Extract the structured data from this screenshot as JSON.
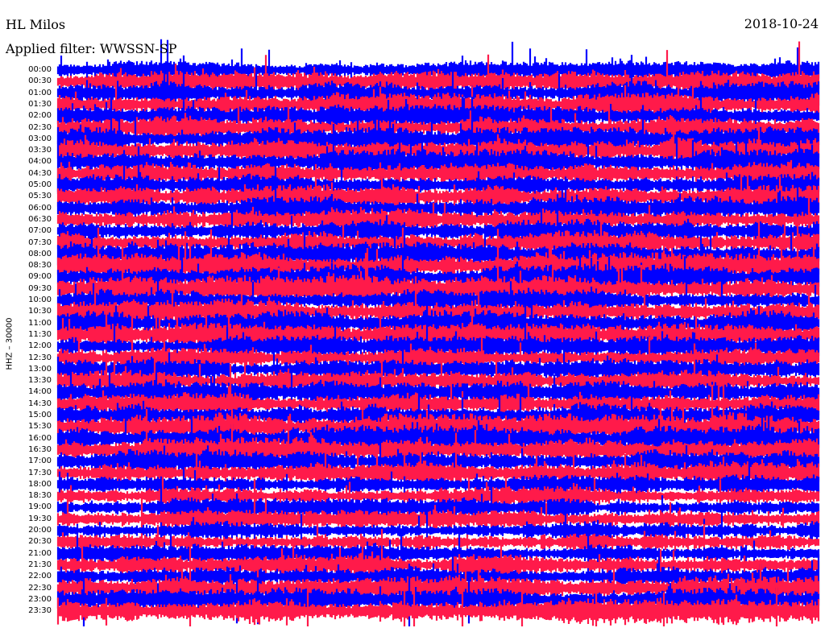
{
  "header": {
    "station": "HL Milos",
    "filter": "Applied filter: WWSSN-SP",
    "date": "2018-10-24"
  },
  "chart_data": {
    "type": "line",
    "title": "",
    "ylabel": "HHZ  –  30000",
    "xlabel": "",
    "grid": false,
    "legend": "none",
    "row_labels": [
      "00:00",
      "00:30",
      "01:00",
      "01:30",
      "02:00",
      "02:30",
      "03:00",
      "03:30",
      "04:00",
      "04:30",
      "05:00",
      "05:30",
      "06:00",
      "06:30",
      "07:00",
      "07:30",
      "08:00",
      "08:30",
      "09:00",
      "09:30",
      "10:00",
      "10:30",
      "11:00",
      "11:30",
      "12:00",
      "12:30",
      "13:00",
      "13:30",
      "14:00",
      "14:30",
      "15:00",
      "15:30",
      "16:00",
      "16:30",
      "17:00",
      "17:30",
      "18:00",
      "18:30",
      "19:00",
      "19:30",
      "20:00",
      "20:30",
      "21:00",
      "21:30",
      "22:00",
      "22:30",
      "23:00",
      "23:30"
    ],
    "colors": [
      "#0000ff",
      "#ff1a4a"
    ],
    "rows": [
      {
        "start": "00:00",
        "color": "#0000ff",
        "amp": 0.8
      },
      {
        "start": "00:30",
        "color": "#ff1a4a",
        "amp": 0.9
      },
      {
        "start": "01:00",
        "color": "#0000ff",
        "amp": 1.0
      },
      {
        "start": "01:30",
        "color": "#ff1a4a",
        "amp": 1.0
      },
      {
        "start": "02:00",
        "color": "#0000ff",
        "amp": 1.0
      },
      {
        "start": "02:30",
        "color": "#ff1a4a",
        "amp": 1.0
      },
      {
        "start": "03:00",
        "color": "#0000ff",
        "amp": 1.0
      },
      {
        "start": "03:30",
        "color": "#ff1a4a",
        "amp": 1.1
      },
      {
        "start": "04:00",
        "color": "#0000ff",
        "amp": 1.1
      },
      {
        "start": "04:30",
        "color": "#ff1a4a",
        "amp": 1.1
      },
      {
        "start": "05:00",
        "color": "#0000ff",
        "amp": 1.0
      },
      {
        "start": "05:30",
        "color": "#ff1a4a",
        "amp": 1.0
      },
      {
        "start": "06:00",
        "color": "#0000ff",
        "amp": 1.0
      },
      {
        "start": "06:30",
        "color": "#ff1a4a",
        "amp": 1.0
      },
      {
        "start": "07:00",
        "color": "#0000ff",
        "amp": 1.0
      },
      {
        "start": "07:30",
        "color": "#ff1a4a",
        "amp": 1.0
      },
      {
        "start": "08:00",
        "color": "#0000ff",
        "amp": 1.0
      },
      {
        "start": "08:30",
        "color": "#ff1a4a",
        "amp": 1.1
      },
      {
        "start": "09:00",
        "color": "#0000ff",
        "amp": 1.1
      },
      {
        "start": "09:30",
        "color": "#ff1a4a",
        "amp": 1.1
      },
      {
        "start": "10:00",
        "color": "#0000ff",
        "amp": 1.0
      },
      {
        "start": "10:30",
        "color": "#ff1a4a",
        "amp": 1.1
      },
      {
        "start": "11:00",
        "color": "#0000ff",
        "amp": 1.1
      },
      {
        "start": "11:30",
        "color": "#ff1a4a",
        "amp": 1.0
      },
      {
        "start": "12:00",
        "color": "#0000ff",
        "amp": 0.9
      },
      {
        "start": "12:30",
        "color": "#ff1a4a",
        "amp": 0.9
      },
      {
        "start": "13:00",
        "color": "#0000ff",
        "amp": 0.9
      },
      {
        "start": "13:30",
        "color": "#ff1a4a",
        "amp": 0.9
      },
      {
        "start": "14:00",
        "color": "#0000ff",
        "amp": 1.0
      },
      {
        "start": "14:30",
        "color": "#ff1a4a",
        "amp": 1.0
      },
      {
        "start": "15:00",
        "color": "#0000ff",
        "amp": 1.1
      },
      {
        "start": "15:30",
        "color": "#ff1a4a",
        "amp": 1.2
      },
      {
        "start": "16:00",
        "color": "#0000ff",
        "amp": 1.1
      },
      {
        "start": "16:30",
        "color": "#ff1a4a",
        "amp": 1.1
      },
      {
        "start": "17:00",
        "color": "#0000ff",
        "amp": 1.0
      },
      {
        "start": "17:30",
        "color": "#ff1a4a",
        "amp": 1.0
      },
      {
        "start": "18:00",
        "color": "#0000ff",
        "amp": 0.8
      },
      {
        "start": "18:30",
        "color": "#ff1a4a",
        "amp": 0.8
      },
      {
        "start": "19:00",
        "color": "#0000ff",
        "amp": 0.8
      },
      {
        "start": "19:30",
        "color": "#ff1a4a",
        "amp": 0.8
      },
      {
        "start": "20:00",
        "color": "#0000ff",
        "amp": 0.8
      },
      {
        "start": "20:30",
        "color": "#ff1a4a",
        "amp": 0.8
      },
      {
        "start": "21:00",
        "color": "#0000ff",
        "amp": 0.8
      },
      {
        "start": "21:30",
        "color": "#ff1a4a",
        "amp": 0.9
      },
      {
        "start": "22:00",
        "color": "#0000ff",
        "amp": 0.9
      },
      {
        "start": "22:30",
        "color": "#ff1a4a",
        "amp": 1.0
      },
      {
        "start": "23:00",
        "color": "#0000ff",
        "amp": 1.0
      },
      {
        "start": "23:30",
        "color": "#ff1a4a",
        "amp": 1.1
      }
    ]
  }
}
